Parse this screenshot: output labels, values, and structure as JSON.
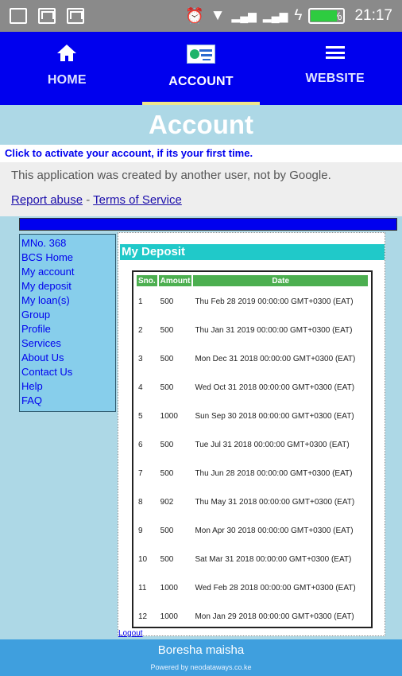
{
  "status_bar": {
    "time": "21:17",
    "battery_text": "77%",
    "battery_level": 0.77,
    "left_icons": [
      "gallery-icon",
      "mail-icon",
      "mail-icon"
    ],
    "right_icons": [
      "alarm-icon",
      "wifi-icon",
      "signal-icon",
      "signal-icon",
      "charging-icon",
      "battery-icon"
    ]
  },
  "nav": {
    "items": [
      {
        "label": "HOME",
        "icon": "home-icon",
        "active": false
      },
      {
        "label": "ACCOUNT",
        "icon": "logo-icon",
        "active": true
      },
      {
        "label": "WEBSITE",
        "icon": "list-icon",
        "active": false
      }
    ],
    "accent": "#0000ee",
    "active_underline": "#f0e68c"
  },
  "banner": {
    "title": "Account"
  },
  "activate_text": "Click to activate your account, if its your first time.",
  "notice": {
    "text": "This application was created by another user, not by Google.",
    "report": "Report abuse",
    "separator": "-",
    "terms": "Terms of Service"
  },
  "sidebar": {
    "items": [
      "MNo. 368",
      "BCS Home",
      "My account",
      "My deposit",
      "My loan(s)",
      "Group",
      "Profile",
      "Services",
      "About Us",
      "Contact Us",
      "Help",
      "FAQ"
    ]
  },
  "deposit": {
    "title": "My Deposit",
    "headers": [
      "Sno.",
      "Amount",
      "Date"
    ],
    "rows": [
      [
        "1",
        "500",
        "Thu Feb 28 2019 00:00:00 GMT+0300 (EAT)"
      ],
      [
        "2",
        "500",
        "Thu Jan 31 2019 00:00:00 GMT+0300 (EAT)"
      ],
      [
        "3",
        "500",
        "Mon Dec 31 2018 00:00:00 GMT+0300 (EAT)"
      ],
      [
        "4",
        "500",
        "Wed Oct 31 2018 00:00:00 GMT+0300 (EAT)"
      ],
      [
        "5",
        "1000",
        "Sun Sep 30 2018 00:00:00 GMT+0300 (EAT)"
      ],
      [
        "6",
        "500",
        "Tue Jul 31 2018 00:00:00 GMT+0300 (EAT)"
      ],
      [
        "7",
        "500",
        "Thu Jun 28 2018 00:00:00 GMT+0300 (EAT)"
      ],
      [
        "8",
        "902",
        "Thu May 31 2018 00:00:00 GMT+0300 (EAT)"
      ],
      [
        "9",
        "500",
        "Mon Apr 30 2018 00:00:00 GMT+0300 (EAT)"
      ],
      [
        "10",
        "500",
        "Sat Mar 31 2018 00:00:00 GMT+0300 (EAT)"
      ],
      [
        "11",
        "1000",
        "Wed Feb 28 2018 00:00:00 GMT+0300 (EAT)"
      ],
      [
        "12",
        "1000",
        "Mon Jan 29 2018 00:00:00 GMT+0300 (EAT)"
      ]
    ],
    "logout": "Logout"
  },
  "footer": {
    "name": "Boresha maisha",
    "powered": "Powered by neodataways.co.ke"
  }
}
